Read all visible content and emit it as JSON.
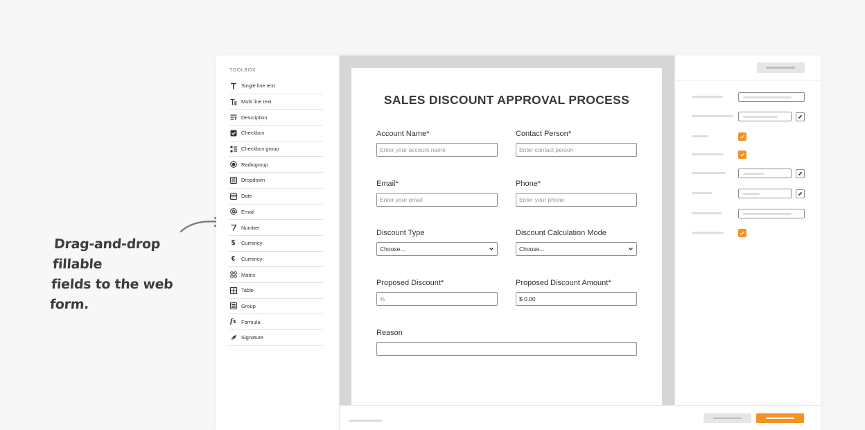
{
  "annotation": {
    "line1": "Drag-and-drop fillable",
    "line2": "fields to the web form."
  },
  "toolbox": {
    "title": "TOOLBOX",
    "items": [
      {
        "label": "Single line text",
        "icon": "text-icon"
      },
      {
        "label": "Multi line text",
        "icon": "multiline-text-icon"
      },
      {
        "label": "Description",
        "icon": "description-icon"
      },
      {
        "label": "Checkbox",
        "icon": "checkbox-icon"
      },
      {
        "label": "Checkbox group",
        "icon": "checkbox-group-icon"
      },
      {
        "label": "Radiogroup",
        "icon": "radio-icon"
      },
      {
        "label": "Dropdown",
        "icon": "dropdown-icon"
      },
      {
        "label": "Date",
        "icon": "calendar-icon"
      },
      {
        "label": "Email",
        "icon": "at-icon"
      },
      {
        "label": "Number",
        "icon": "number-icon"
      },
      {
        "label": "Currency",
        "icon": "dollar-icon"
      },
      {
        "label": "Currency",
        "icon": "euro-icon"
      },
      {
        "label": "Matrix",
        "icon": "matrix-icon"
      },
      {
        "label": "Table",
        "icon": "table-icon"
      },
      {
        "label": "Group",
        "icon": "group-icon"
      },
      {
        "label": "Formula",
        "icon": "formula-icon"
      },
      {
        "label": "Signature",
        "icon": "signature-icon"
      }
    ]
  },
  "form": {
    "title": "SALES DISCOUNT APPROVAL PROCESS",
    "account_name": {
      "label": "Account Name*",
      "placeholder": "Enter your account name"
    },
    "contact_person": {
      "label": "Contact Person*",
      "placeholder": "Enter contact person"
    },
    "email": {
      "label": "Email*",
      "placeholder": "Enter your email"
    },
    "phone": {
      "label": "Phone*",
      "placeholder": "Enter your phone"
    },
    "discount_type": {
      "label": "Discount Type",
      "selected": "Choose..."
    },
    "calc_mode": {
      "label": "Discount Calculation Mode",
      "selected": "Choose..."
    },
    "proposed_discount": {
      "label": "Proposed Discount*",
      "placeholder": "%"
    },
    "proposed_amount": {
      "label": "Proposed Discount Amount*",
      "value": "$ 0.00"
    },
    "reason": {
      "label": "Reason",
      "value": ""
    }
  },
  "colors": {
    "accent": "#f7921e",
    "canvas": "#d6d6d6",
    "text": "#333333"
  }
}
